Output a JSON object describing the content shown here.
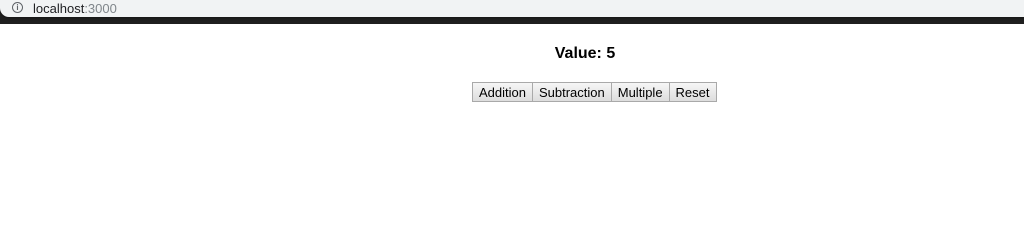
{
  "browser": {
    "url_host": "localhost",
    "url_port": ":3000",
    "info_icon": "info-icon"
  },
  "main": {
    "value_label": "Value: 5",
    "buttons": {
      "addition": "Addition",
      "subtraction": "Subtraction",
      "multiple": "Multiple",
      "reset": "Reset"
    }
  }
}
